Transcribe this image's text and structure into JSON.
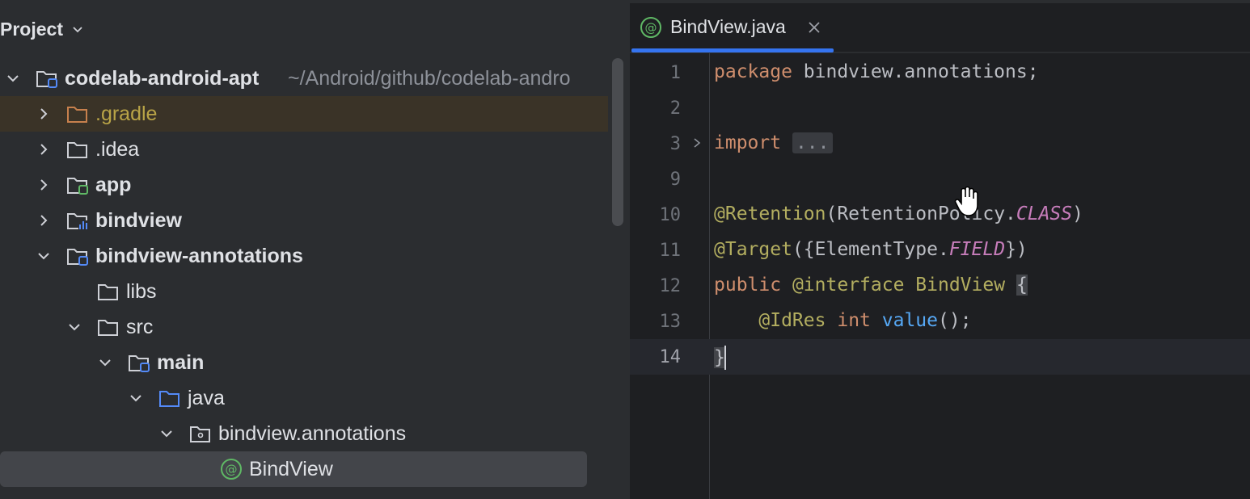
{
  "project_panel": {
    "title": "Project",
    "tree": [
      {
        "label": "codelab-android-apt",
        "path": "~/Android/github/codelab-andro",
        "expanded": true,
        "bold": true,
        "icon": "module-folder-icon"
      },
      {
        "label": ".gradle",
        "expanded": false,
        "icon": "folder-icon"
      },
      {
        "label": ".idea",
        "expanded": false,
        "icon": "folder-icon"
      },
      {
        "label": "app",
        "expanded": false,
        "bold": true,
        "icon": "android-module-icon"
      },
      {
        "label": "bindview",
        "expanded": false,
        "bold": true,
        "icon": "library-module-icon"
      },
      {
        "label": "bindview-annotations",
        "expanded": true,
        "bold": true,
        "icon": "module-folder-icon"
      },
      {
        "label": "libs",
        "icon": "folder-icon"
      },
      {
        "label": "src",
        "expanded": true,
        "icon": "folder-icon"
      },
      {
        "label": "main",
        "expanded": true,
        "bold": true,
        "icon": "source-set-icon"
      },
      {
        "label": "java",
        "expanded": true,
        "icon": "source-root-icon"
      },
      {
        "label": "bindview.annotations",
        "expanded": true,
        "icon": "package-icon"
      },
      {
        "label": "BindView",
        "selected": true,
        "icon": "annotation-icon"
      }
    ]
  },
  "editor": {
    "tab": {
      "label": "BindView.java"
    },
    "lines": [
      {
        "num": "1"
      },
      {
        "num": "2"
      },
      {
        "num": "3"
      },
      {
        "num": "9"
      },
      {
        "num": "10"
      },
      {
        "num": "11"
      },
      {
        "num": "12"
      },
      {
        "num": "13"
      },
      {
        "num": "14"
      }
    ],
    "code": {
      "l1_kw": "package",
      "l1_rest": " bindview.annotations;",
      "l3_kw": "import",
      "l3_fold": "...",
      "l10_ann": "@Retention",
      "l10_a": "(RetentionPolicy.",
      "l10_const": "CLASS",
      "l10_b": ")",
      "l11_ann": "@Target",
      "l11_a": "({ElementType.",
      "l11_const": "FIELD",
      "l11_b": "})",
      "l12_kw1": "public",
      "l12_kw2": "@interface",
      "l12_name": "BindView",
      "l12_brace": "{",
      "l13_indent": "    ",
      "l13_ann": "@IdRes",
      "l13_kw": "int",
      "l13_meth": "value",
      "l13_rest": "();",
      "l14_brace": "}"
    }
  },
  "colors": {
    "accent": "#3574f0",
    "keyword": "#cf8e6d",
    "annotation": "#b3ae60",
    "constant": "#c77dbb",
    "method": "#56a8f5"
  }
}
